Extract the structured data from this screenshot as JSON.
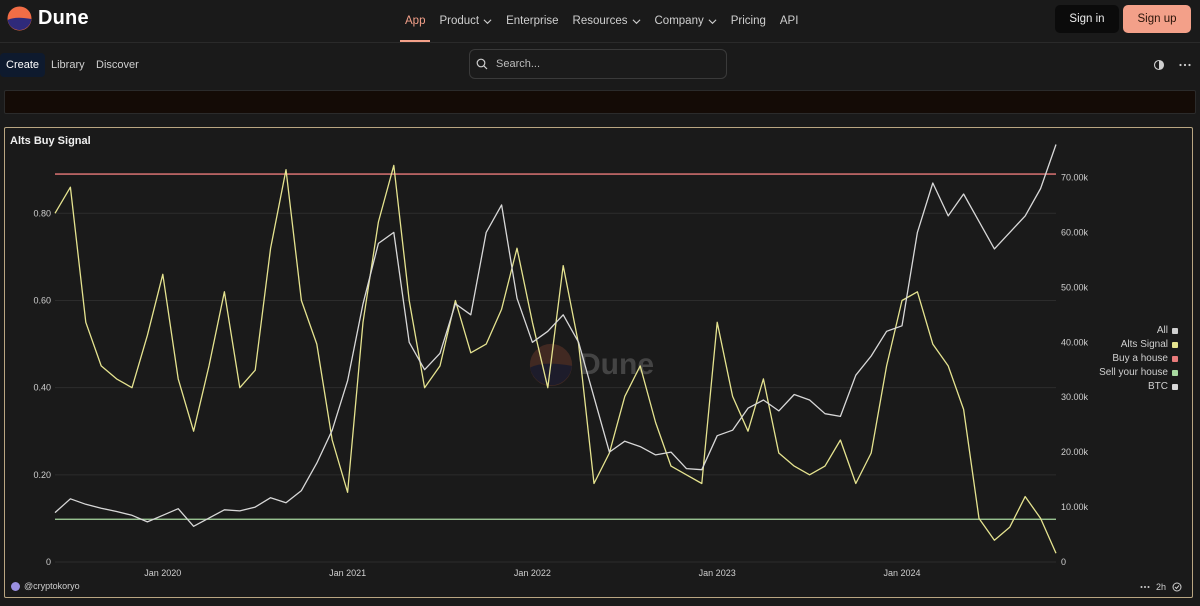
{
  "app": {
    "brand": "Dune",
    "brand_color": "#f3a089"
  },
  "topnav": {
    "links": [
      {
        "label": "App",
        "active": true,
        "dropdown": false
      },
      {
        "label": "Product",
        "active": false,
        "dropdown": true
      },
      {
        "label": "Enterprise",
        "active": false,
        "dropdown": false
      },
      {
        "label": "Resources",
        "active": false,
        "dropdown": true
      },
      {
        "label": "Company",
        "active": false,
        "dropdown": true
      },
      {
        "label": "Pricing",
        "active": false,
        "dropdown": false
      },
      {
        "label": "API",
        "active": false,
        "dropdown": false
      }
    ],
    "sign_in": "Sign in",
    "sign_up": "Sign up"
  },
  "subnav": {
    "tabs": [
      {
        "label": "Create",
        "active": true
      },
      {
        "label": "Library",
        "active": false
      },
      {
        "label": "Discover",
        "active": false
      }
    ],
    "search_placeholder": "Search...",
    "icons": [
      "theme-toggle-icon",
      "more-icon"
    ]
  },
  "panel": {
    "title": "Alts Buy Signal",
    "author": "@cryptokoryo",
    "refresh": "2h",
    "watermark": "Dune"
  },
  "chart_data": {
    "type": "line",
    "title": "Alts Buy Signal",
    "x_ticks": [
      "Jan 2020",
      "Jan 2021",
      "Jan 2022",
      "Jan 2023",
      "Jan 2024"
    ],
    "x_range": [
      "2019-06",
      "2024-11"
    ],
    "y_left": {
      "ticks": [
        "0",
        "0.20",
        "0.40",
        "0.60",
        "0.80"
      ],
      "range": [
        0,
        0.92
      ]
    },
    "y_right": {
      "ticks": [
        "0",
        "10.00k",
        "20.00k",
        "30.00k",
        "40.00k",
        "50.00k",
        "60.00k",
        "70.00k"
      ],
      "range": [
        0,
        73000
      ]
    },
    "legend": [
      {
        "name": "All",
        "color": "#cfcfcf"
      },
      {
        "name": "Alts Signal",
        "color": "#e5e38f"
      },
      {
        "name": "Buy a house",
        "color": "#e97b7b"
      },
      {
        "name": "Sell your house",
        "color": "#a8d9a0"
      },
      {
        "name": "BTC",
        "color": "#d8d8d8"
      }
    ],
    "legend_position": "right",
    "grid": true,
    "series": [
      {
        "name": "Buy a house",
        "axis": "left",
        "constant": 0.89
      },
      {
        "name": "Sell your house",
        "axis": "left",
        "constant": 0.098
      },
      {
        "name": "Alts Signal",
        "axis": "left",
        "x": [
          "2019-06",
          "2019-07",
          "2019-08",
          "2019-09",
          "2019-10",
          "2019-11",
          "2019-12",
          "2020-01",
          "2020-02",
          "2020-03",
          "2020-04",
          "2020-05",
          "2020-06",
          "2020-07",
          "2020-08",
          "2020-09",
          "2020-10",
          "2020-11",
          "2020-12",
          "2021-01",
          "2021-02",
          "2021-03",
          "2021-04",
          "2021-05",
          "2021-06",
          "2021-07",
          "2021-08",
          "2021-09",
          "2021-10",
          "2021-11",
          "2021-12",
          "2022-01",
          "2022-02",
          "2022-03",
          "2022-04",
          "2022-05",
          "2022-06",
          "2022-07",
          "2022-08",
          "2022-09",
          "2022-10",
          "2022-11",
          "2022-12",
          "2023-01",
          "2023-02",
          "2023-03",
          "2023-04",
          "2023-05",
          "2023-06",
          "2023-07",
          "2023-08",
          "2023-09",
          "2023-10",
          "2023-11",
          "2023-12",
          "2024-01",
          "2024-02",
          "2024-03",
          "2024-04",
          "2024-05",
          "2024-06",
          "2024-07",
          "2024-08",
          "2024-09",
          "2024-10",
          "2024-11"
        ],
        "values": [
          0.8,
          0.86,
          0.55,
          0.45,
          0.42,
          0.4,
          0.52,
          0.66,
          0.42,
          0.3,
          0.45,
          0.62,
          0.4,
          0.44,
          0.72,
          0.9,
          0.6,
          0.5,
          0.28,
          0.16,
          0.55,
          0.78,
          0.91,
          0.6,
          0.4,
          0.45,
          0.6,
          0.48,
          0.5,
          0.58,
          0.72,
          0.55,
          0.4,
          0.68,
          0.5,
          0.18,
          0.25,
          0.38,
          0.45,
          0.32,
          0.22,
          0.2,
          0.18,
          0.55,
          0.38,
          0.3,
          0.42,
          0.25,
          0.22,
          0.2,
          0.22,
          0.28,
          0.18,
          0.25,
          0.45,
          0.6,
          0.62,
          0.5,
          0.45,
          0.35,
          0.1,
          0.05,
          0.08,
          0.15,
          0.1,
          0.02
        ]
      },
      {
        "name": "BTC",
        "axis": "right",
        "x": [
          "2019-06",
          "2019-07",
          "2019-08",
          "2019-09",
          "2019-10",
          "2019-11",
          "2019-12",
          "2020-01",
          "2020-02",
          "2020-03",
          "2020-04",
          "2020-05",
          "2020-06",
          "2020-07",
          "2020-08",
          "2020-09",
          "2020-10",
          "2020-11",
          "2020-12",
          "2021-01",
          "2021-02",
          "2021-03",
          "2021-04",
          "2021-05",
          "2021-06",
          "2021-07",
          "2021-08",
          "2021-09",
          "2021-10",
          "2021-11",
          "2021-12",
          "2022-01",
          "2022-02",
          "2022-03",
          "2022-04",
          "2022-05",
          "2022-06",
          "2022-07",
          "2022-08",
          "2022-09",
          "2022-10",
          "2022-11",
          "2022-12",
          "2023-01",
          "2023-02",
          "2023-03",
          "2023-04",
          "2023-05",
          "2023-06",
          "2023-07",
          "2023-08",
          "2023-09",
          "2023-10",
          "2023-11",
          "2023-12",
          "2024-01",
          "2024-02",
          "2024-03",
          "2024-04",
          "2024-05",
          "2024-06",
          "2024-07",
          "2024-08",
          "2024-09",
          "2024-10",
          "2024-11"
        ],
        "values": [
          9000,
          11500,
          10500,
          9800,
          9200,
          8500,
          7300,
          8500,
          9700,
          6500,
          8000,
          9500,
          9300,
          10000,
          11700,
          10800,
          13000,
          18000,
          24000,
          33000,
          47000,
          58000,
          60000,
          40000,
          35000,
          38000,
          47000,
          45000,
          60000,
          65000,
          48000,
          40000,
          42000,
          45000,
          40000,
          30000,
          20000,
          22000,
          21000,
          19500,
          20000,
          17000,
          16800,
          23000,
          24000,
          28000,
          29500,
          27500,
          30500,
          29500,
          27000,
          26500,
          34000,
          37500,
          42000,
          43000,
          60000,
          69000,
          63000,
          67000,
          62000,
          57000,
          60000,
          63000,
          68000,
          76000
        ]
      }
    ]
  }
}
